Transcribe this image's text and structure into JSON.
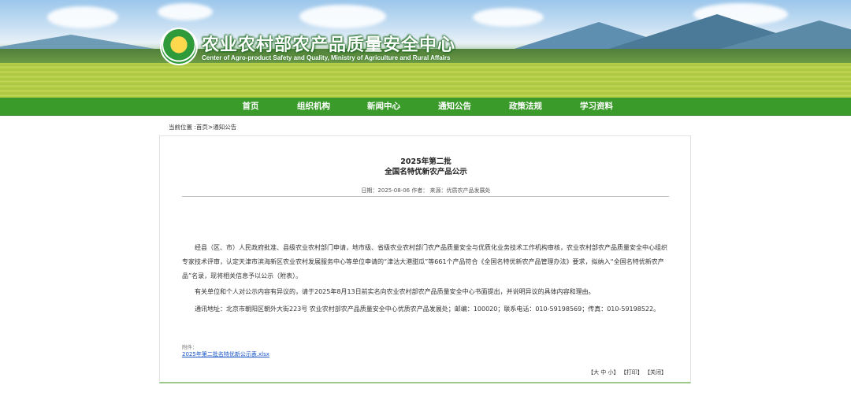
{
  "header": {
    "org_name_cn": "农业农村部农产品质量安全中心",
    "org_name_en": "Center of Agro-product Safety and Quality, Ministry of Agriculture and Rural Affairs",
    "logo_icon": "casq-logo-icon"
  },
  "nav": {
    "items": [
      {
        "label": "首页"
      },
      {
        "label": "组织机构"
      },
      {
        "label": "新闻中心"
      },
      {
        "label": "通知公告"
      },
      {
        "label": "政策法规"
      },
      {
        "label": "学习资料"
      }
    ]
  },
  "breadcrumb": {
    "prefix": "当前位置 :",
    "home": "首页",
    "sep": ">",
    "current": "通知公告"
  },
  "article": {
    "title_line1": "2025年第二批",
    "title_line2": "全国名特优新农产品公示",
    "meta": "日期：2025-08-06 作者：  来源：优质农产品发展处",
    "paragraphs": [
      "经县（区、市）人民政府批准、县级农业农村部门申请，地市级、省级农业农村部门农产品质量安全与优质化业务技术工作机构审核，农业农村部农产品质量安全中心组织专家技术评审，认定天津市滨海新区农业农村发展服务中心等单位申请的“津沽大港甜瓜”等661个产品符合《全国名特优新农产品管理办法》要求，拟纳入“全国名特优新农产品”名录，现将相关信息予以公示（附表）。",
      "有关单位和个人对公示内容有异议的，请于2025年8月13日前实名向农业农村部农产品质量安全中心书面提出，并说明异议的具体内容和理由。",
      "通讯地址：北京市朝阳区朝外大街223号 农业农村部农产品质量安全中心优质农产品发展处；邮编：100020；联系电话：010-59198569；传真：010-59198522。"
    ],
    "attachment_label": "附件：",
    "attachment_file": "2025年第二批名特优新公示表.xlsx"
  },
  "tools": {
    "font_size": "【大 中 小】",
    "print": "【打印】",
    "close": "【关闭】"
  },
  "colors": {
    "nav_bg": "#3b9b2a",
    "link": "#1a56c9",
    "accent_border": "#9bc98a"
  }
}
